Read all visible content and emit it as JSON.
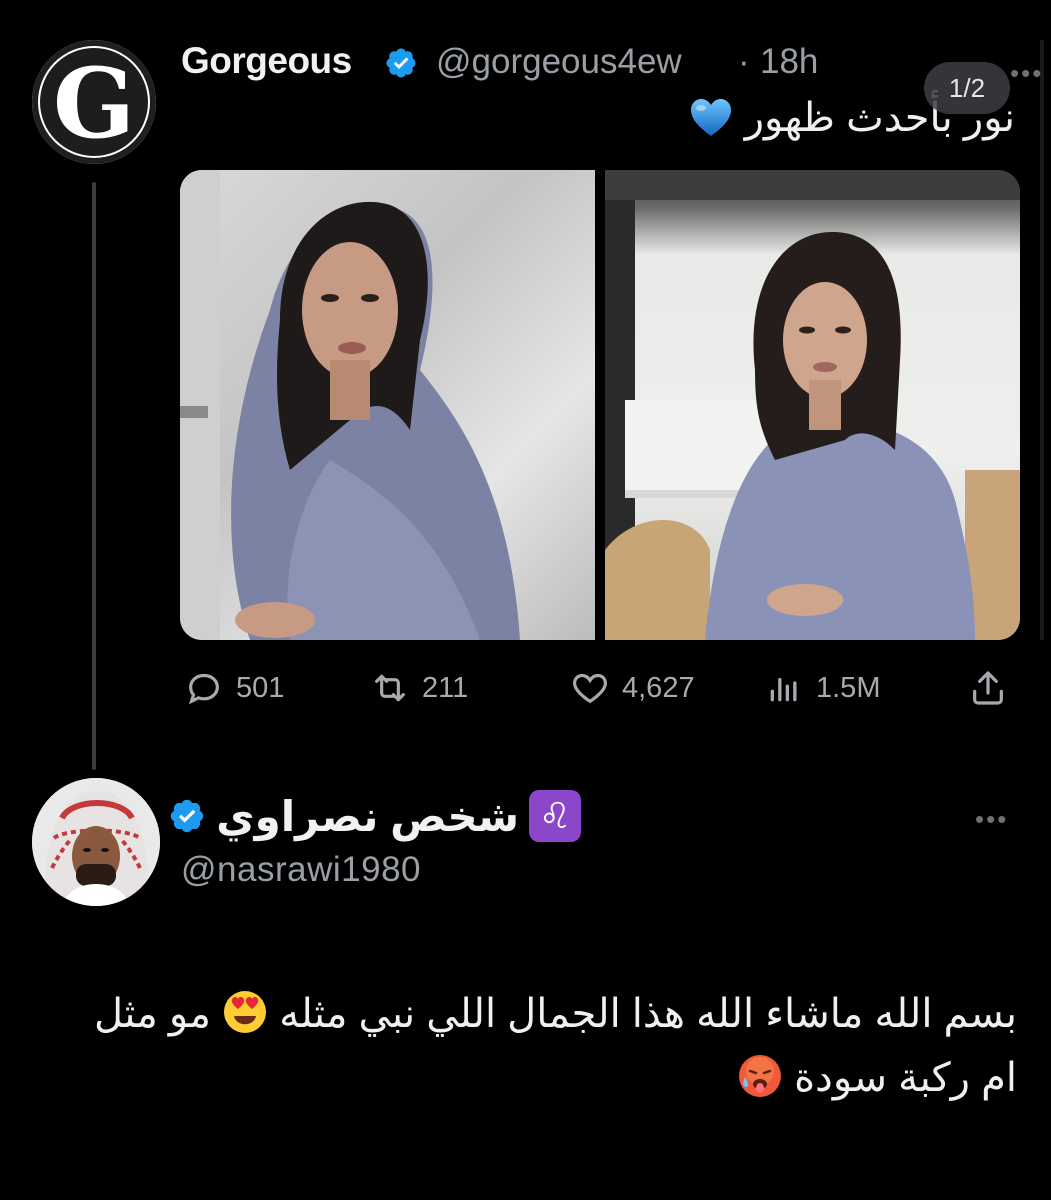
{
  "tweet": {
    "author_name": "Gorgeous",
    "author_handle": "@gorgeous4ew",
    "separator": "·",
    "time": "18h",
    "avatar_letter": "G",
    "text": "نور بأحدث ظهور",
    "media_counter": "1/2",
    "stats": {
      "replies": "501",
      "retweets": "211",
      "likes": "4,627",
      "views": "1.5M"
    }
  },
  "reply": {
    "author_name": "شخص نصراوي",
    "zodiac_badge": "♌",
    "author_handle": "@nasrawi1980",
    "text_part1": "بسم الله ماشاء الله هذا الجمال اللي نبي مثله",
    "text_part2": "مو مثل ام ركبة سودة"
  },
  "icons": {
    "verified": "verified-badge-icon",
    "blue_heart": "blue-heart-emoji",
    "heart_eyes": "heart-eyes-emoji",
    "hot_face": "hot-face-emoji"
  },
  "colors": {
    "background": "#000000",
    "verified_blue": "#1d9bf0",
    "leo_badge": "#8b46c9",
    "muted_text": "#9a9fa5"
  }
}
